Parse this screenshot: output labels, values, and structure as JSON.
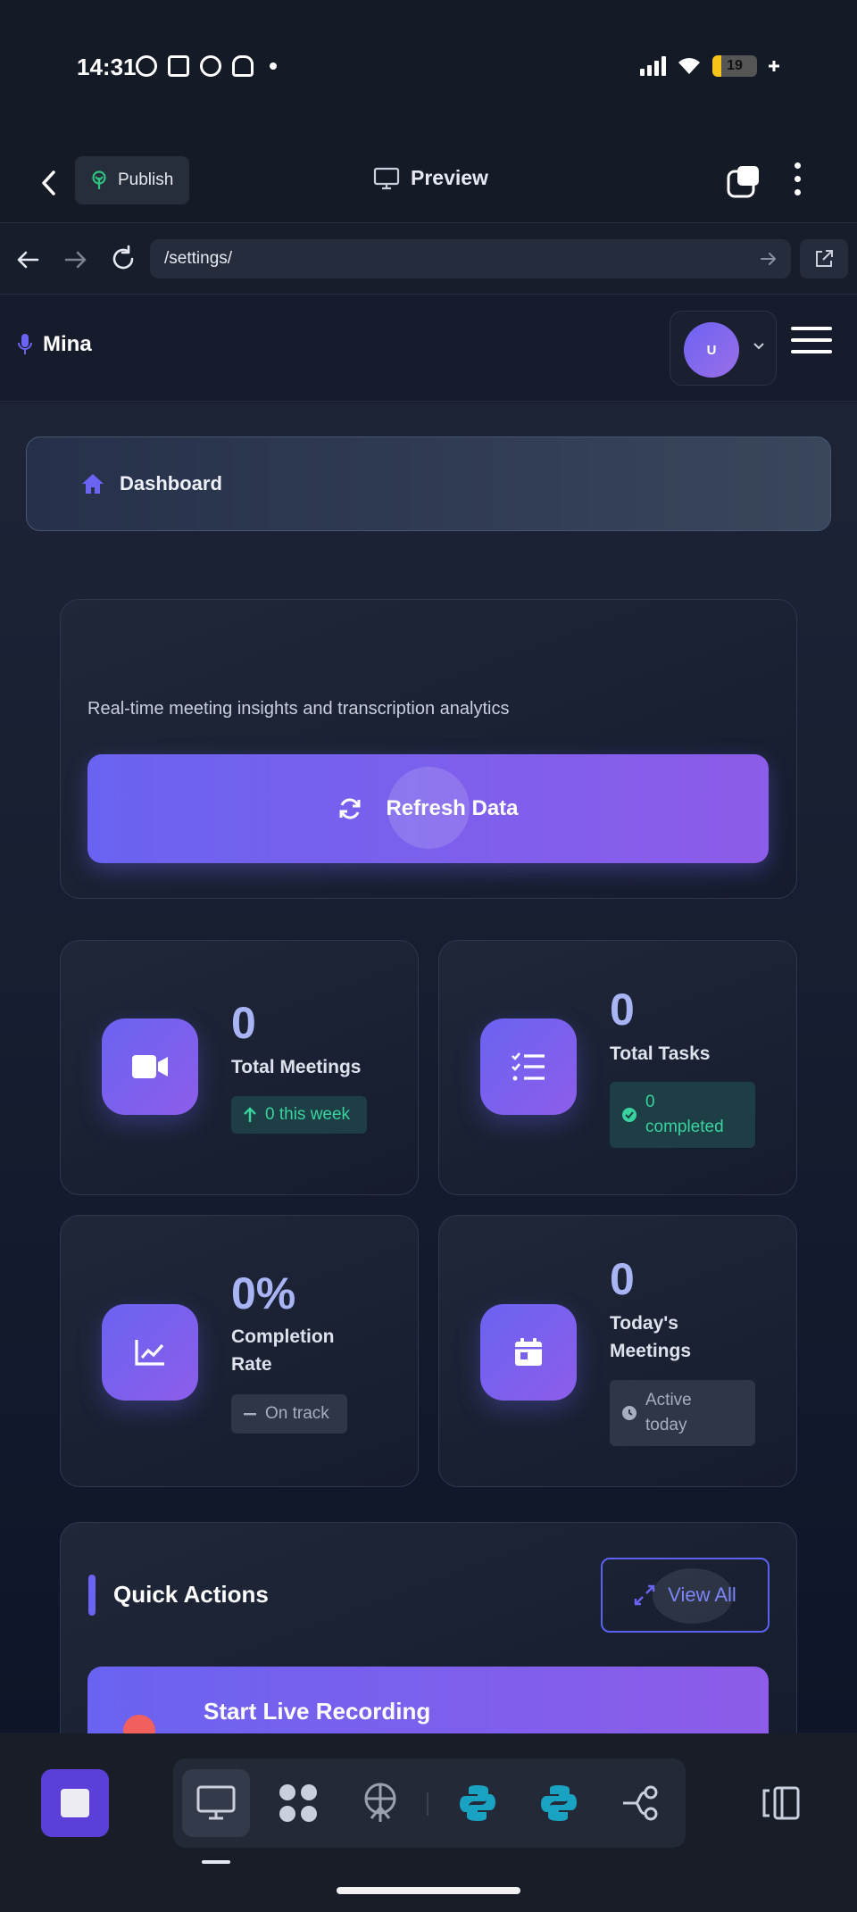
{
  "status_bar": {
    "time": "14:31",
    "battery": "19",
    "battery_level": 0.19
  },
  "app_bar": {
    "publish_label": "Publish",
    "preview_label": "Preview"
  },
  "browser": {
    "url": "/settings/"
  },
  "header": {
    "brand": "Mina",
    "avatar_initial": "U"
  },
  "breadcrumb": {
    "label": "Dashboard"
  },
  "hero": {
    "subtitle": "Real-time meeting insights and transcription analytics",
    "refresh_label": "Refresh Data"
  },
  "stats": {
    "meetings": {
      "value": "0",
      "label": "Total Meetings",
      "badge": "0 this week"
    },
    "tasks": {
      "value": "0",
      "label": "Total Tasks",
      "badge_line1": "0",
      "badge_line2": "completed"
    },
    "completion": {
      "value": "0%",
      "label_line1": "Completion",
      "label_line2": "Rate",
      "badge": "On track"
    },
    "today": {
      "value": "0",
      "label_line1": "Today's",
      "label_line2": "Meetings",
      "badge_line1": "Active",
      "badge_line2": "today"
    }
  },
  "quick_actions": {
    "title": "Quick Actions",
    "view_all_label": "View All",
    "start_recording_label": "Start Live Recording"
  },
  "colors": {
    "accent": "#6b63f2",
    "accent_end": "#8d5ce8",
    "success": "#38d39f",
    "record": "#f15f5f",
    "background": "#151b2b"
  }
}
